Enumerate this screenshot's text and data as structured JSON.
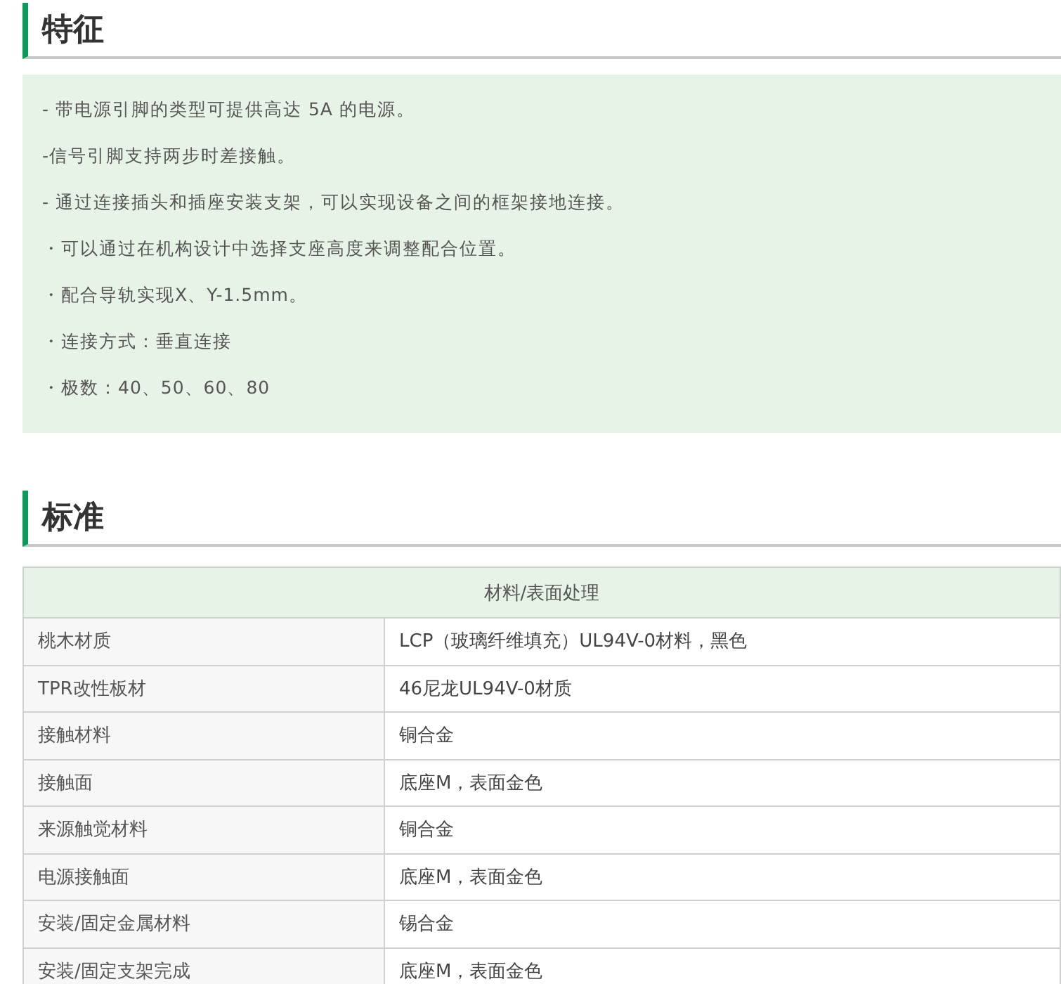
{
  "features": {
    "title": "特征",
    "items": [
      "- 带电源引脚的类型可提供高达 5A 的电源。",
      "-信号引脚支持两步时差接触。",
      "- 通过连接插头和插座安装支架，可以实现设备之间的框架接地连接。",
      "・可以通过在机构设计中选择支座高度来调整配合位置。",
      "・配合导轨实现X、Y-1.5mm。",
      "・连接方式：垂直连接",
      "・极数：40、50、60、80"
    ]
  },
  "standard": {
    "title": "标准",
    "table": {
      "header": "材料/表面处理",
      "rows": [
        {
          "label": "桃木材质",
          "value": "LCP（玻璃纤维填充）UL94V-0材料，黑色"
        },
        {
          "label": "TPR改性板材",
          "value": "46尼龙UL94V-0材质"
        },
        {
          "label": "接触材料",
          "value": "铜合金"
        },
        {
          "label": "接触面",
          "value": "底座M，表面金色"
        },
        {
          "label": "来源触觉材料",
          "value": "铜合金"
        },
        {
          "label": "电源接触面",
          "value": "底座M，表面金色"
        },
        {
          "label": "安装/固定金属材料",
          "value": "锡合金"
        },
        {
          "label": "安装/固定支架完成",
          "value": "底座M，表面金色"
        }
      ]
    }
  }
}
